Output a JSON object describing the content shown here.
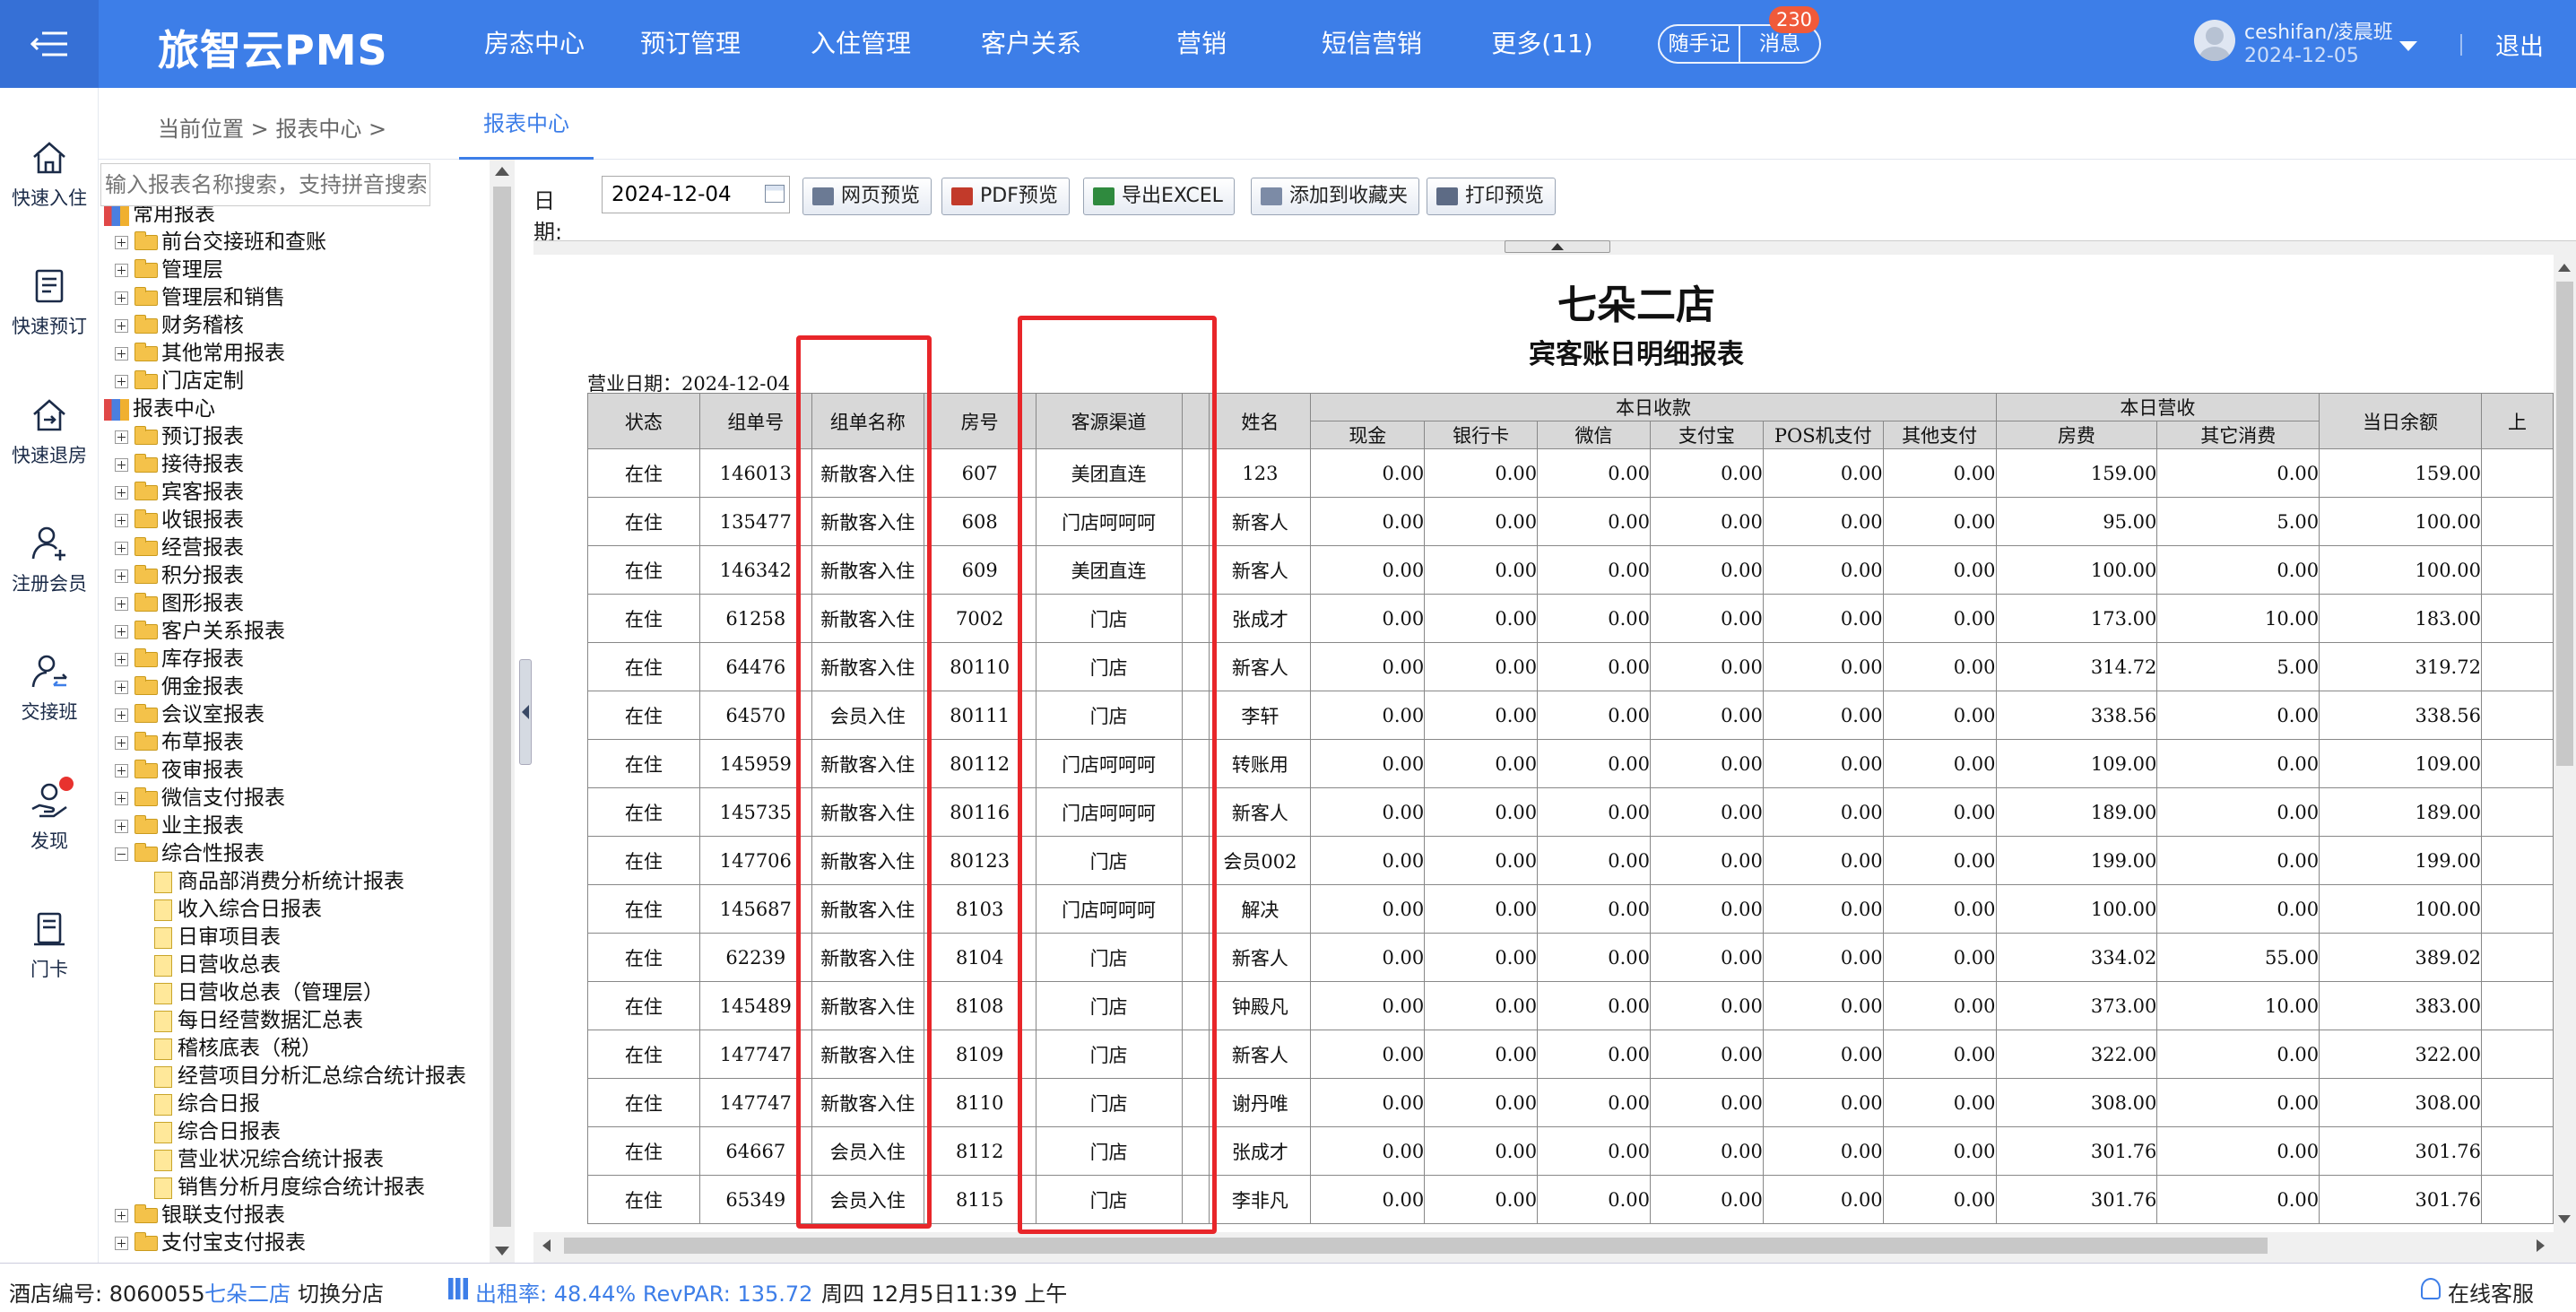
{
  "brand": "旅智云PMS",
  "nav": [
    "房态中心",
    "预订管理",
    "入住管理",
    "客户关系",
    "营销",
    "短信营销",
    "更多(11)"
  ],
  "header_pills": {
    "note": "随手记",
    "message": "消息",
    "message_badge": "230"
  },
  "user": {
    "name": "ceshifan/凌晨班",
    "date": "2024-12-05"
  },
  "logout": "退出",
  "rail": [
    "快速入住",
    "快速预订",
    "快速退房",
    "注册会员",
    "交接班",
    "发现",
    "门卡"
  ],
  "breadcrumb": {
    "text": "当前位置 > 报表中心 >",
    "tab": "报表中心"
  },
  "tree": {
    "search_placeholder": "输入报表名称搜索，支持拼音搜索",
    "nodes": [
      {
        "label": "常用报表",
        "level": 0,
        "type": "root"
      },
      {
        "label": "前台交接班和查账",
        "level": 1,
        "type": "folder"
      },
      {
        "label": "管理层",
        "level": 1,
        "type": "folder"
      },
      {
        "label": "管理层和销售",
        "level": 1,
        "type": "folder"
      },
      {
        "label": "财务稽核",
        "level": 1,
        "type": "folder"
      },
      {
        "label": "其他常用报表",
        "level": 1,
        "type": "folder"
      },
      {
        "label": "门店定制",
        "level": 1,
        "type": "folder"
      },
      {
        "label": "报表中心",
        "level": 0,
        "type": "root"
      },
      {
        "label": "预订报表",
        "level": 1,
        "type": "folder"
      },
      {
        "label": "接待报表",
        "level": 1,
        "type": "folder"
      },
      {
        "label": "宾客报表",
        "level": 1,
        "type": "folder"
      },
      {
        "label": "收银报表",
        "level": 1,
        "type": "folder"
      },
      {
        "label": "经营报表",
        "level": 1,
        "type": "folder"
      },
      {
        "label": "积分报表",
        "level": 1,
        "type": "folder"
      },
      {
        "label": "图形报表",
        "level": 1,
        "type": "folder"
      },
      {
        "label": "客户关系报表",
        "level": 1,
        "type": "folder"
      },
      {
        "label": "库存报表",
        "level": 1,
        "type": "folder"
      },
      {
        "label": "佣金报表",
        "level": 1,
        "type": "folder"
      },
      {
        "label": "会议室报表",
        "level": 1,
        "type": "folder"
      },
      {
        "label": "布草报表",
        "level": 1,
        "type": "folder"
      },
      {
        "label": "夜审报表",
        "level": 1,
        "type": "folder"
      },
      {
        "label": "微信支付报表",
        "level": 1,
        "type": "folder"
      },
      {
        "label": "业主报表",
        "level": 1,
        "type": "folder"
      },
      {
        "label": "综合性报表",
        "level": 1,
        "type": "open"
      },
      {
        "label": "商品部消费分析统计报表",
        "level": 2,
        "type": "file"
      },
      {
        "label": "收入综合日报表",
        "level": 2,
        "type": "file"
      },
      {
        "label": "日审项目表",
        "level": 2,
        "type": "file"
      },
      {
        "label": "日营收总表",
        "level": 2,
        "type": "file"
      },
      {
        "label": "日营收总表（管理层）",
        "level": 2,
        "type": "file"
      },
      {
        "label": "每日经营数据汇总表",
        "level": 2,
        "type": "file"
      },
      {
        "label": "稽核底表（税）",
        "level": 2,
        "type": "file"
      },
      {
        "label": "经营项目分析汇总综合统计报表",
        "level": 2,
        "type": "file"
      },
      {
        "label": "综合日报",
        "level": 2,
        "type": "file"
      },
      {
        "label": "综合日报表",
        "level": 2,
        "type": "file"
      },
      {
        "label": "营业状况综合统计报表",
        "level": 2,
        "type": "file"
      },
      {
        "label": "销售分析月度综合统计报表",
        "level": 2,
        "type": "file"
      },
      {
        "label": "银联支付报表",
        "level": 1,
        "type": "folder"
      },
      {
        "label": "支付宝支付报表",
        "level": 1,
        "type": "folder"
      }
    ]
  },
  "toolbar": {
    "date_label": "日期:",
    "date_value": "2024-12-04",
    "buttons": [
      "网页预览",
      "PDF预览",
      "导出EXCEL",
      "添加到收藏夹",
      "打印预览"
    ]
  },
  "report": {
    "hotel": "七朵二店",
    "title": "宾客账日明细报表",
    "business_date": "营业日期：2024-12-04",
    "group_today_receipts": "本日收款",
    "group_today_revenue": "本日营收",
    "headers": {
      "status": "状态",
      "group_no": "组单号",
      "group_name": "组单名称",
      "room": "房号",
      "channel": "客源渠道",
      "name": "姓名",
      "cash": "现金",
      "bank_card": "银行卡",
      "wechat": "微信",
      "alipay": "支付宝",
      "pos": "POS机支付",
      "other_pay": "其他支付",
      "room_fee": "房费",
      "other_consume": "其它消费",
      "balance": "当日余额",
      "prev": "上"
    },
    "rows": [
      {
        "status": "在住",
        "group_no": "146013",
        "group_name": "新散客入住",
        "room": "607",
        "channel": "美团直连",
        "name": "123",
        "cash": "0.00",
        "bank_card": "0.00",
        "wechat": "0.00",
        "alipay": "0.00",
        "pos": "0.00",
        "other_pay": "0.00",
        "room_fee": "159.00",
        "other_consume": "0.00",
        "balance": "159.00"
      },
      {
        "status": "在住",
        "group_no": "135477",
        "group_name": "新散客入住",
        "room": "608",
        "channel": "门店呵呵呵",
        "name": "新客人",
        "cash": "0.00",
        "bank_card": "0.00",
        "wechat": "0.00",
        "alipay": "0.00",
        "pos": "0.00",
        "other_pay": "0.00",
        "room_fee": "95.00",
        "other_consume": "5.00",
        "balance": "100.00"
      },
      {
        "status": "在住",
        "group_no": "146342",
        "group_name": "新散客入住",
        "room": "609",
        "channel": "美团直连",
        "name": "新客人",
        "cash": "0.00",
        "bank_card": "0.00",
        "wechat": "0.00",
        "alipay": "0.00",
        "pos": "0.00",
        "other_pay": "0.00",
        "room_fee": "100.00",
        "other_consume": "0.00",
        "balance": "100.00"
      },
      {
        "status": "在住",
        "group_no": "61258",
        "group_name": "新散客入住",
        "room": "7002",
        "channel": "门店",
        "name": "张成才",
        "cash": "0.00",
        "bank_card": "0.00",
        "wechat": "0.00",
        "alipay": "0.00",
        "pos": "0.00",
        "other_pay": "0.00",
        "room_fee": "173.00",
        "other_consume": "10.00",
        "balance": "183.00"
      },
      {
        "status": "在住",
        "group_no": "64476",
        "group_name": "新散客入住",
        "room": "80110",
        "channel": "门店",
        "name": "新客人",
        "cash": "0.00",
        "bank_card": "0.00",
        "wechat": "0.00",
        "alipay": "0.00",
        "pos": "0.00",
        "other_pay": "0.00",
        "room_fee": "314.72",
        "other_consume": "5.00",
        "balance": "319.72"
      },
      {
        "status": "在住",
        "group_no": "64570",
        "group_name": "会员入住",
        "room": "80111",
        "channel": "门店",
        "name": "李轩",
        "cash": "0.00",
        "bank_card": "0.00",
        "wechat": "0.00",
        "alipay": "0.00",
        "pos": "0.00",
        "other_pay": "0.00",
        "room_fee": "338.56",
        "other_consume": "0.00",
        "balance": "338.56"
      },
      {
        "status": "在住",
        "group_no": "145959",
        "group_name": "新散客入住",
        "room": "80112",
        "channel": "门店呵呵呵",
        "name": "转账用",
        "cash": "0.00",
        "bank_card": "0.00",
        "wechat": "0.00",
        "alipay": "0.00",
        "pos": "0.00",
        "other_pay": "0.00",
        "room_fee": "109.00",
        "other_consume": "0.00",
        "balance": "109.00"
      },
      {
        "status": "在住",
        "group_no": "145735",
        "group_name": "新散客入住",
        "room": "80116",
        "channel": "门店呵呵呵",
        "name": "新客人",
        "cash": "0.00",
        "bank_card": "0.00",
        "wechat": "0.00",
        "alipay": "0.00",
        "pos": "0.00",
        "other_pay": "0.00",
        "room_fee": "189.00",
        "other_consume": "0.00",
        "balance": "189.00"
      },
      {
        "status": "在住",
        "group_no": "147706",
        "group_name": "新散客入住",
        "room": "80123",
        "channel": "门店",
        "name": "会员002",
        "cash": "0.00",
        "bank_card": "0.00",
        "wechat": "0.00",
        "alipay": "0.00",
        "pos": "0.00",
        "other_pay": "0.00",
        "room_fee": "199.00",
        "other_consume": "0.00",
        "balance": "199.00"
      },
      {
        "status": "在住",
        "group_no": "145687",
        "group_name": "新散客入住",
        "room": "8103",
        "channel": "门店呵呵呵",
        "name": "解决",
        "cash": "0.00",
        "bank_card": "0.00",
        "wechat": "0.00",
        "alipay": "0.00",
        "pos": "0.00",
        "other_pay": "0.00",
        "room_fee": "100.00",
        "other_consume": "0.00",
        "balance": "100.00"
      },
      {
        "status": "在住",
        "group_no": "62239",
        "group_name": "新散客入住",
        "room": "8104",
        "channel": "门店",
        "name": "新客人",
        "cash": "0.00",
        "bank_card": "0.00",
        "wechat": "0.00",
        "alipay": "0.00",
        "pos": "0.00",
        "other_pay": "0.00",
        "room_fee": "334.02",
        "other_consume": "55.00",
        "balance": "389.02"
      },
      {
        "status": "在住",
        "group_no": "145489",
        "group_name": "新散客入住",
        "room": "8108",
        "channel": "门店",
        "name": "钟殿凡",
        "cash": "0.00",
        "bank_card": "0.00",
        "wechat": "0.00",
        "alipay": "0.00",
        "pos": "0.00",
        "other_pay": "0.00",
        "room_fee": "373.00",
        "other_consume": "10.00",
        "balance": "383.00"
      },
      {
        "status": "在住",
        "group_no": "147747",
        "group_name": "新散客入住",
        "room": "8109",
        "channel": "门店",
        "name": "新客人",
        "cash": "0.00",
        "bank_card": "0.00",
        "wechat": "0.00",
        "alipay": "0.00",
        "pos": "0.00",
        "other_pay": "0.00",
        "room_fee": "322.00",
        "other_consume": "0.00",
        "balance": "322.00"
      },
      {
        "status": "在住",
        "group_no": "147747",
        "group_name": "新散客入住",
        "room": "8110",
        "channel": "门店",
        "name": "谢丹唯",
        "cash": "0.00",
        "bank_card": "0.00",
        "wechat": "0.00",
        "alipay": "0.00",
        "pos": "0.00",
        "other_pay": "0.00",
        "room_fee": "308.00",
        "other_consume": "0.00",
        "balance": "308.00"
      },
      {
        "status": "在住",
        "group_no": "64667",
        "group_name": "会员入住",
        "room": "8112",
        "channel": "门店",
        "name": "张成才",
        "cash": "0.00",
        "bank_card": "0.00",
        "wechat": "0.00",
        "alipay": "0.00",
        "pos": "0.00",
        "other_pay": "0.00",
        "room_fee": "301.76",
        "other_consume": "0.00",
        "balance": "301.76"
      },
      {
        "status": "在住",
        "group_no": "65349",
        "group_name": "会员入住",
        "room": "8115",
        "channel": "门店",
        "name": "李非凡",
        "cash": "0.00",
        "bank_card": "0.00",
        "wechat": "0.00",
        "alipay": "0.00",
        "pos": "0.00",
        "other_pay": "0.00",
        "room_fee": "301.76",
        "other_consume": "0.00",
        "balance": "301.76"
      }
    ]
  },
  "statusbar": {
    "hotel_no": "酒店编号: 8060055",
    "hotel_name": "七朵二店",
    "switch": "切换分店",
    "occupancy": "出租率: 48.44% RevPAR: 135.72",
    "datetime": "周四 12月5日11:39 上午",
    "service": "在线客服"
  },
  "colors": {
    "topbar": "#3d7ee8",
    "accent": "#3d7ee8",
    "highlight_box": "#e8262a",
    "badge": "#f05a3a"
  }
}
